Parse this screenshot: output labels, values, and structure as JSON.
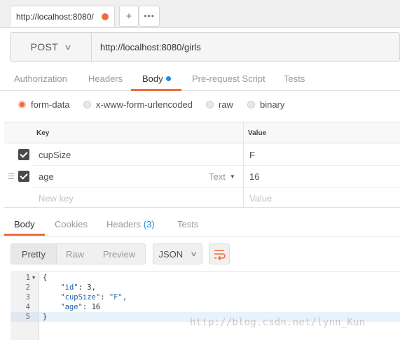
{
  "tabs": {
    "active_tab_url": "http://localhost:8080/",
    "new_tab": "+",
    "more": "•••"
  },
  "request": {
    "method": "POST",
    "url": "http://localhost:8080/girls"
  },
  "request_tabs": [
    {
      "label": "Authorization"
    },
    {
      "label": "Headers"
    },
    {
      "label": "Body",
      "active": true,
      "indicator": true
    },
    {
      "label": "Pre-request Script"
    },
    {
      "label": "Tests"
    }
  ],
  "body_types": [
    {
      "label": "form-data",
      "selected": true
    },
    {
      "label": "x-www-form-urlencoded"
    },
    {
      "label": "raw"
    },
    {
      "label": "binary"
    }
  ],
  "params": {
    "key_header": "Key",
    "value_header": "Value",
    "rows": [
      {
        "key": "cupSize",
        "value": "F",
        "checked": true
      },
      {
        "key": "age",
        "value": "16",
        "checked": true,
        "type": "Text"
      }
    ],
    "key_placeholder": "New key",
    "value_placeholder": "Value"
  },
  "response_tabs": [
    {
      "label": "Body",
      "active": true
    },
    {
      "label": "Cookies"
    },
    {
      "label": "Headers",
      "count": "(3)"
    },
    {
      "label": "Tests"
    }
  ],
  "view_modes": [
    {
      "label": "Pretty",
      "active": true
    },
    {
      "label": "Raw"
    },
    {
      "label": "Preview"
    }
  ],
  "format": "JSON",
  "response_code": [
    {
      "n": "1",
      "text": "{"
    },
    {
      "n": "2",
      "key": "\"id\"",
      "val": "3,"
    },
    {
      "n": "3",
      "key": "\"cupSize\"",
      "sval": "\"F\","
    },
    {
      "n": "4",
      "key": "\"age\"",
      "val": "16"
    },
    {
      "n": "5",
      "text": "}"
    }
  ],
  "watermark": "http://blog.csdn.net/lynn_Kun",
  "colors": {
    "accent": "#f26b3a",
    "blue": "#1a8ce0"
  }
}
